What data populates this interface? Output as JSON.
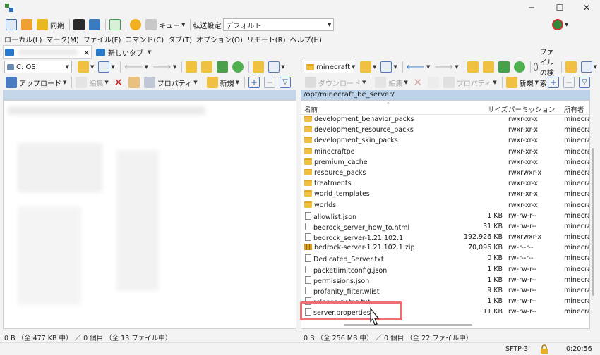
{
  "window": {
    "minimize": "─",
    "maximize": "☐",
    "close": "✕"
  },
  "toolbar1": {
    "sync_label": "同期",
    "queue_label": "キュー",
    "transfer_label": "転送設定",
    "transfer_value": "デフォルト"
  },
  "menu": [
    "ローカル(L)",
    "マーク(M)",
    "ファイル(F)",
    "コマンド(C)",
    "タブ(T)",
    "オプション(O)",
    "リモート(R)",
    "ヘルプ(H)"
  ],
  "tabs": {
    "new_tab": "新しいタブ",
    "close": "×"
  },
  "left": {
    "drive": "C: OS",
    "upload_label": "アップロード",
    "edit_label": "編集",
    "props_label": "プロパティ",
    "new_label": "新規",
    "status": "0 B （全 477 KB 中） ／ 0 個目 （全 13 ファイル中）"
  },
  "right": {
    "location": "minecraft",
    "search_label": "ファイルの検索",
    "download_label": "ダウンロード",
    "edit_label": "編集",
    "props_label": "プロパティ",
    "new_label": "新規",
    "path": "/opt/minecraft_be_server/",
    "columns": {
      "name": "名前",
      "size": "サイズ",
      "perm": "パーミッション",
      "owner": "所有者"
    },
    "files": [
      {
        "name": "development_behavior_packs",
        "type": "folder",
        "size": "",
        "perm": "rwxr-xr-x",
        "owner": "minecraft"
      },
      {
        "name": "development_resource_packs",
        "type": "folder",
        "size": "",
        "perm": "rwxr-xr-x",
        "owner": "minecraft"
      },
      {
        "name": "development_skin_packs",
        "type": "folder",
        "size": "",
        "perm": "rwxr-xr-x",
        "owner": "minecraft"
      },
      {
        "name": "minecraftpe",
        "type": "folder",
        "size": "",
        "perm": "rwxr-xr-x",
        "owner": "minecraft"
      },
      {
        "name": "premium_cache",
        "type": "folder",
        "size": "",
        "perm": "rwxr-xr-x",
        "owner": "minecraft"
      },
      {
        "name": "resource_packs",
        "type": "folder",
        "size": "",
        "perm": "rwxrwxr-x",
        "owner": "minecraft"
      },
      {
        "name": "treatments",
        "type": "folder",
        "size": "",
        "perm": "rwxr-xr-x",
        "owner": "minecraft"
      },
      {
        "name": "world_templates",
        "type": "folder",
        "size": "",
        "perm": "rwxr-xr-x",
        "owner": "minecraft"
      },
      {
        "name": "worlds",
        "type": "folder",
        "size": "",
        "perm": "rwxr-xr-x",
        "owner": "minecraft"
      },
      {
        "name": "allowlist.json",
        "type": "json",
        "size": "1 KB",
        "perm": "rw-rw-r--",
        "owner": "minecraft"
      },
      {
        "name": "bedrock_server_how_to.html",
        "type": "html",
        "size": "31 KB",
        "perm": "rw-rw-r--",
        "owner": "minecraft"
      },
      {
        "name": "bedrock_server-1.21.102.1",
        "type": "file",
        "size": "192,926 KB",
        "perm": "rwxrwxr-x",
        "owner": "minecraft"
      },
      {
        "name": "bedrock-server-1.21.102.1.zip",
        "type": "zip",
        "size": "70,096 KB",
        "perm": "rw-r--r--",
        "owner": "minecraft"
      },
      {
        "name": "Dedicated_Server.txt",
        "type": "file",
        "size": "0 KB",
        "perm": "rw-r--r--",
        "owner": "minecraft"
      },
      {
        "name": "packetlimitconfig.json",
        "type": "json",
        "size": "1 KB",
        "perm": "rw-rw-r--",
        "owner": "minecraft"
      },
      {
        "name": "permissions.json",
        "type": "json",
        "size": "1 KB",
        "perm": "rw-rw-r--",
        "owner": "minecraft"
      },
      {
        "name": "profanity_filter.wlist",
        "type": "file",
        "size": "9 KB",
        "perm": "rw-rw-r--",
        "owner": "minecraft"
      },
      {
        "name": "release-notes.txt",
        "type": "file",
        "size": "1 KB",
        "perm": "rw-rw-r--",
        "owner": "minecraft"
      },
      {
        "name": "server.properties",
        "type": "file",
        "size": "11 KB",
        "perm": "rw-rw-r--",
        "owner": "minecraft"
      }
    ],
    "status": "0 B （全 256 MB 中） ／ 0 個目 （全 22 ファイル中）"
  },
  "statusbar": {
    "protocol": "SFTP-3",
    "time": "0:20:56"
  },
  "colors": {
    "folder": "#f0c040",
    "path_bar": "#bcd3ea",
    "highlight": "#ec6f74"
  }
}
